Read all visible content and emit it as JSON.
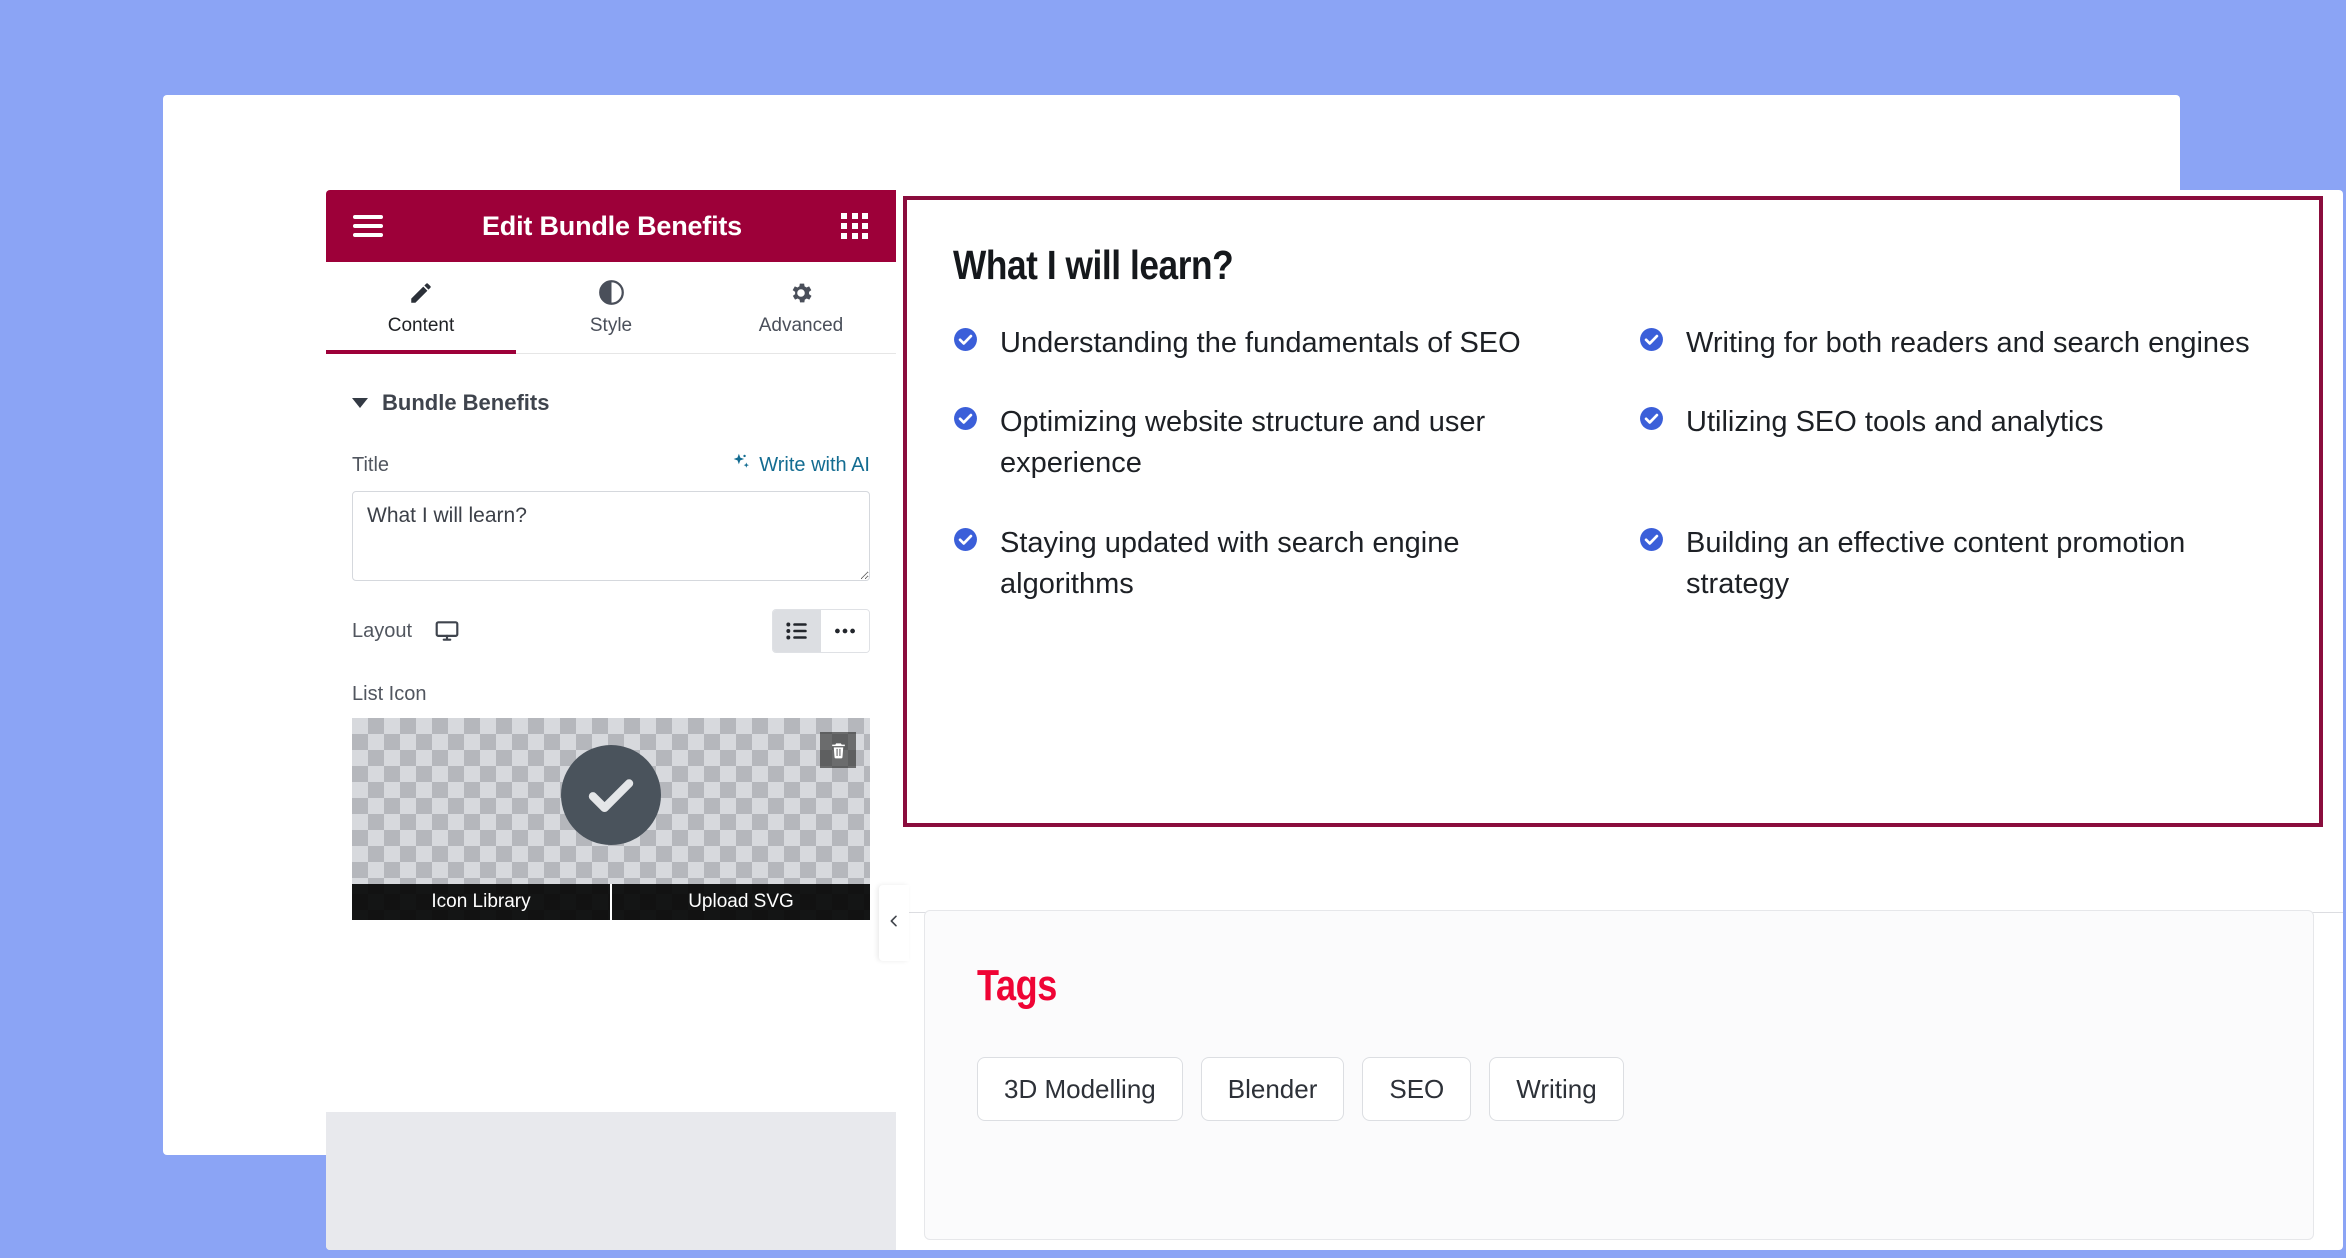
{
  "theme": {
    "page_bg": "#8ba4f5",
    "panel_header_bg": "#9d0039",
    "accent_maroon": "#8a0d3d",
    "check_blue": "#3b5fd9",
    "tags_red": "#ef0435",
    "ai_link_teal": "#136c91"
  },
  "panel": {
    "title": "Edit Bundle Benefits",
    "menu_icon": "hamburger-icon",
    "apps_icon": "grid-apps-icon",
    "tabs": [
      {
        "label": "Content",
        "icon": "pencil-icon",
        "active": true
      },
      {
        "label": "Style",
        "icon": "contrast-icon",
        "active": false
      },
      {
        "label": "Advanced",
        "icon": "gear-icon",
        "active": false
      }
    ],
    "section": {
      "label": "Bundle Benefits",
      "expanded": true
    },
    "title_field": {
      "label": "Title",
      "value": "What I will learn?",
      "placeholder": "",
      "ai_label": "Write with AI",
      "ai_icon": "sparkle-icon"
    },
    "layout_field": {
      "label": "Layout",
      "device_icon": "desktop-monitor-icon",
      "options": [
        {
          "name": "list-view",
          "icon": "list-icon",
          "active": true
        },
        {
          "name": "more-view",
          "icon": "ellipsis-icon",
          "active": false
        }
      ]
    },
    "list_icon_field": {
      "label": "List Icon",
      "preview_icon": "check-circle-icon",
      "delete_icon": "trash-icon",
      "actions": [
        "Icon Library",
        "Upload SVG"
      ]
    }
  },
  "preview": {
    "collapse_icon": "chevron-left-icon",
    "benefits": {
      "title": "What I will learn?",
      "item_icon": "check-circle-icon",
      "items": [
        "Understanding the fundamentals of SEO",
        "Writing for both readers and search engines",
        "Optimizing website structure and user experience",
        "Utilizing SEO tools and analytics",
        "Staying updated with search engine algorithms",
        "Building an effective content promotion strategy"
      ]
    },
    "tags": {
      "title": "Tags",
      "items": [
        "3D Modelling",
        "Blender",
        "SEO",
        "Writing"
      ]
    }
  }
}
